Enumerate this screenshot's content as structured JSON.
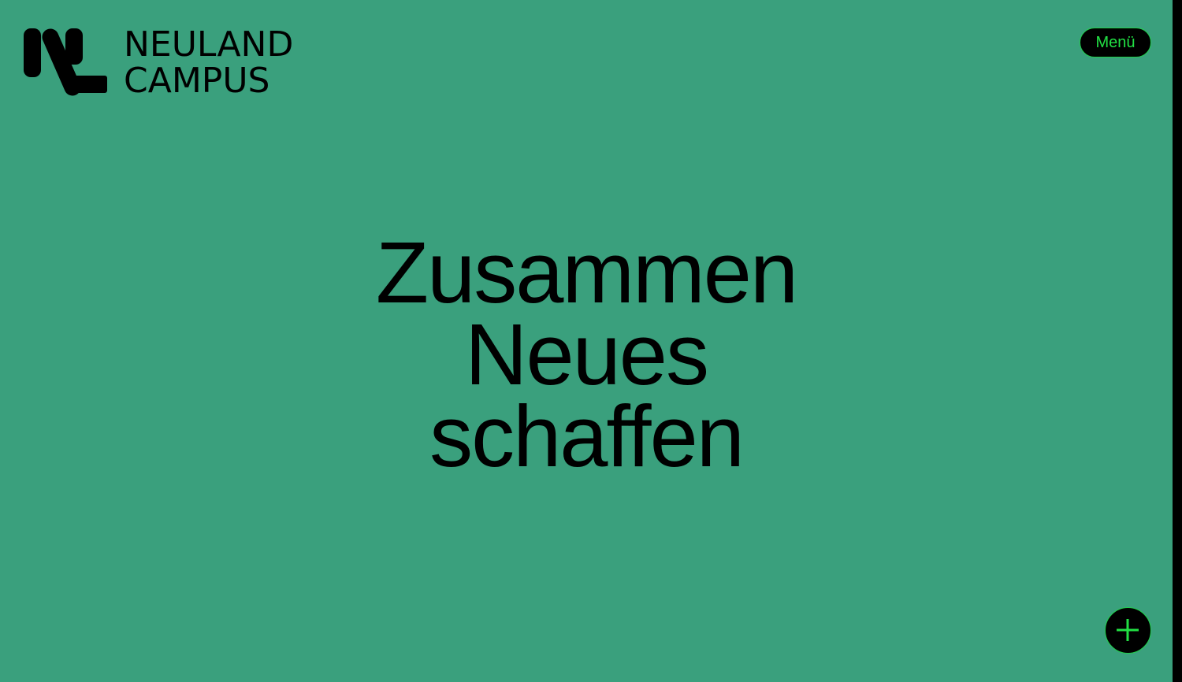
{
  "header": {
    "logo": {
      "line1": "NEULAND",
      "line2": "CAMPUS",
      "mark_icon": "neuland-logo-mark-icon"
    },
    "menu_label": "Menü"
  },
  "hero": {
    "lines": [
      "Zusammen",
      "Neues",
      "schaffen"
    ]
  },
  "fab": {
    "icon": "plus-icon"
  },
  "colors": {
    "background": "#3aa07d",
    "text": "#000000",
    "accent": "#22e044",
    "scrollbar": "#000000"
  }
}
